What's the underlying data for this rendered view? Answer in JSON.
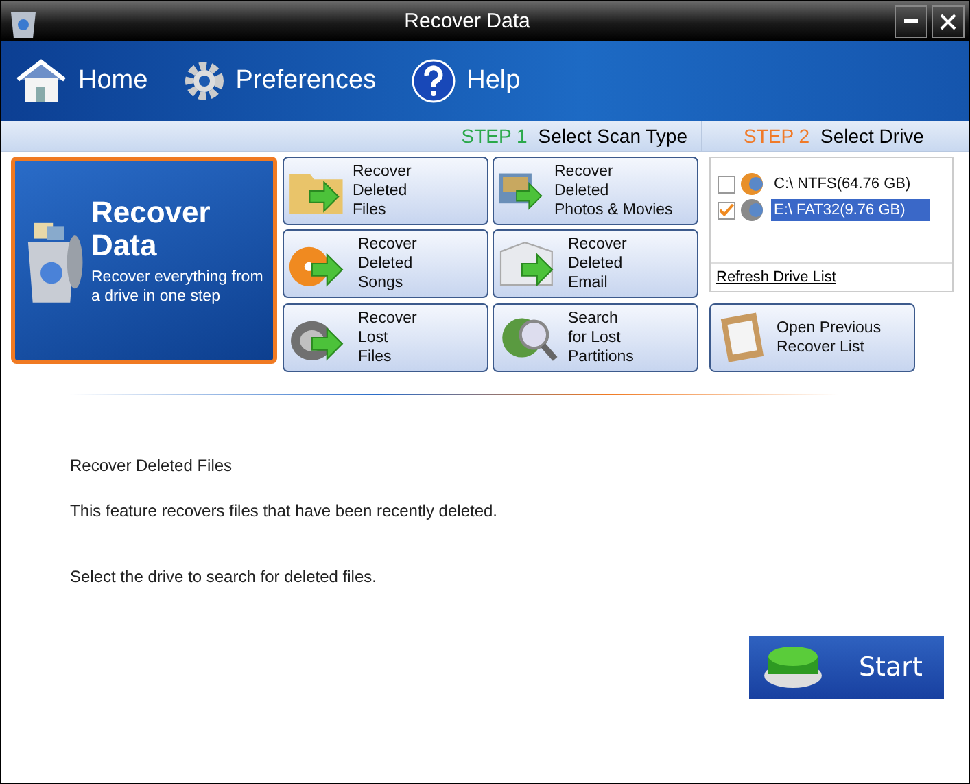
{
  "window": {
    "title": "Recover Data"
  },
  "nav": [
    {
      "label": "Home"
    },
    {
      "label": "Preferences"
    },
    {
      "label": "Help"
    }
  ],
  "steps": [
    {
      "number": "STEP 1",
      "label": "Select Scan Type",
      "color": "#2aa84a"
    },
    {
      "number": "STEP 2",
      "label": "Select Drive",
      "color": "#f07a28"
    }
  ],
  "featured": {
    "title": "Recover\nData",
    "description": "Recover everything from a drive in one step",
    "selected": true
  },
  "scan_options": [
    {
      "label": "Recover\nDeleted\nFiles",
      "selected": false
    },
    {
      "label": "Recover\nDeleted\nPhotos & Movies",
      "selected": false
    },
    {
      "label": "Recover\nDeleted\nSongs",
      "selected": false
    },
    {
      "label": "Recover\nDeleted\nEmail",
      "selected": false
    },
    {
      "label": "Recover\nLost\nFiles",
      "selected": false
    },
    {
      "label": "Search\nfor Lost\nPartitions",
      "selected": false
    }
  ],
  "drives": [
    {
      "label": "C:\\ NTFS(64.76 GB)",
      "checked": false,
      "selected": false,
      "color": "#e8902a"
    },
    {
      "label": "E:\\ FAT32(9.76 GB)",
      "checked": true,
      "selected": true,
      "color": "#8a8a8a"
    }
  ],
  "refresh_link": "Refresh Drive List",
  "open_previous": "Open Previous\nRecover List",
  "description": {
    "title": "Recover Deleted Files",
    "body": "This feature recovers files that have been recently deleted.",
    "hint": "Select the drive to search for deleted files."
  },
  "start_button": "Start"
}
